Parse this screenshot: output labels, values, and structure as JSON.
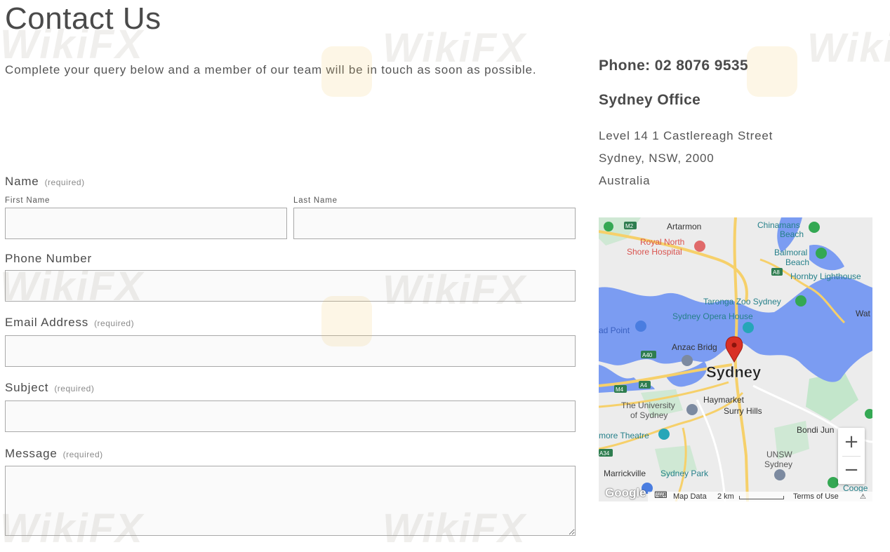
{
  "page": {
    "title": "Contact Us",
    "intro": "Complete your query below and a member of our team will be in touch as soon as possible."
  },
  "form": {
    "name_label": "Name",
    "required_text": "(required)",
    "first_name_label": "First Name",
    "last_name_label": "Last Name",
    "phone_label": "Phone Number",
    "email_label": "Email Address",
    "subject_label": "Subject",
    "message_label": "Message"
  },
  "sidebar": {
    "phone": "Phone: 02 8076 9535",
    "office_title": "Sydney Office",
    "address_lines": [
      "Level 14 1 Castlereagh Street",
      "Sydney, NSW, 2000",
      "Australia"
    ]
  },
  "map": {
    "city_label": "Sydney",
    "places": {
      "artarmon": "Artarmon",
      "chinamans": "Chinamans",
      "beach": "Beach",
      "royal_north": "Royal North",
      "shore_hospital": "Shore Hospital",
      "balmoral": "Balmoral",
      "hornby": "Hornby Lighthouse",
      "taronga": "Taronga Zoo Sydney",
      "opera": "Sydney Opera House",
      "ad_point": "ad Point",
      "anzac": "Anzac Bridg",
      "wat": "Wat",
      "haymarket": "Haymarket",
      "surry": "Surry Hills",
      "university": "The University",
      "of_sydney": "of Sydney",
      "bondi": "Bondi Jun",
      "theatre": "more Theatre",
      "unsw": "UNSW",
      "unsw_sydney": "Sydney",
      "marrickville": "Marrickville",
      "sydney_park": "Sydney Park",
      "cooge": "Cooge"
    },
    "roads": {
      "m2": "M2",
      "a8": "A8",
      "a40": "A40",
      "a4": "A4",
      "m4": "M4",
      "a34": "A34"
    },
    "zoom_in": "+",
    "zoom_out": "−",
    "google_logo": "Google",
    "map_data": "Map Data",
    "scale": "2 km",
    "terms": "Terms of Use"
  },
  "watermark": {
    "text": "WikiFX"
  },
  "colors": {
    "water": "#7b9cf2",
    "land": "#ececec",
    "park": "#b8e3c4",
    "road": "#f6d06a",
    "pin": "#d93025"
  },
  "icons": {
    "pin": "map-pin-icon",
    "keyboard": "keyboard-icon",
    "report": "report-icon"
  }
}
